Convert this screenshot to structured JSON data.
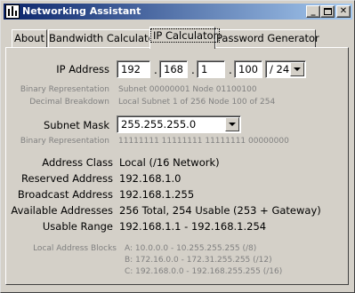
{
  "window": {
    "title": "Networking Assistant"
  },
  "tabs": [
    {
      "label": "About"
    },
    {
      "label": "Bandwidth Calculator"
    },
    {
      "label": "IP Calculator"
    },
    {
      "label": "Password Generator"
    }
  ],
  "active_tab": "IP Calculator",
  "ip": {
    "label": "IP Address",
    "octets": [
      "192",
      "168",
      "1",
      "100"
    ],
    "cidr": "/ 24",
    "binary_label": "Binary Representation",
    "binary_value": "Subnet 00000001  Node 01100100",
    "decimal_label": "Decimal Breakdown",
    "decimal_value": "Local Subnet 1 of 256 Node 100 of 254"
  },
  "mask": {
    "label": "Subnet Mask",
    "value": "255.255.255.0",
    "binary_label": "Binary Representation",
    "binary_value": "11111111 11111111 11111111 00000000"
  },
  "results": [
    {
      "label": "Address Class",
      "value": "Local (/16 Network)"
    },
    {
      "label": "Reserved Address",
      "value": "192.168.1.0"
    },
    {
      "label": "Broadcast Address",
      "value": "192.168.1.255"
    },
    {
      "label": "Available Addresses",
      "value": "256 Total, 254 Usable (253 + Gateway)"
    },
    {
      "label": "Usable Range",
      "value": "192.168.1.1 - 192.168.1.254"
    }
  ],
  "blocks": {
    "label": "Local Address Blocks",
    "lines": [
      "A: 10.0.0.0 - 10.255.255.255  (/8)",
      "B: 172.16.0.0 - 172.31.255.255  (/12)",
      "C: 192.168.0.0 - 192.168.255.255  (/16)"
    ]
  }
}
